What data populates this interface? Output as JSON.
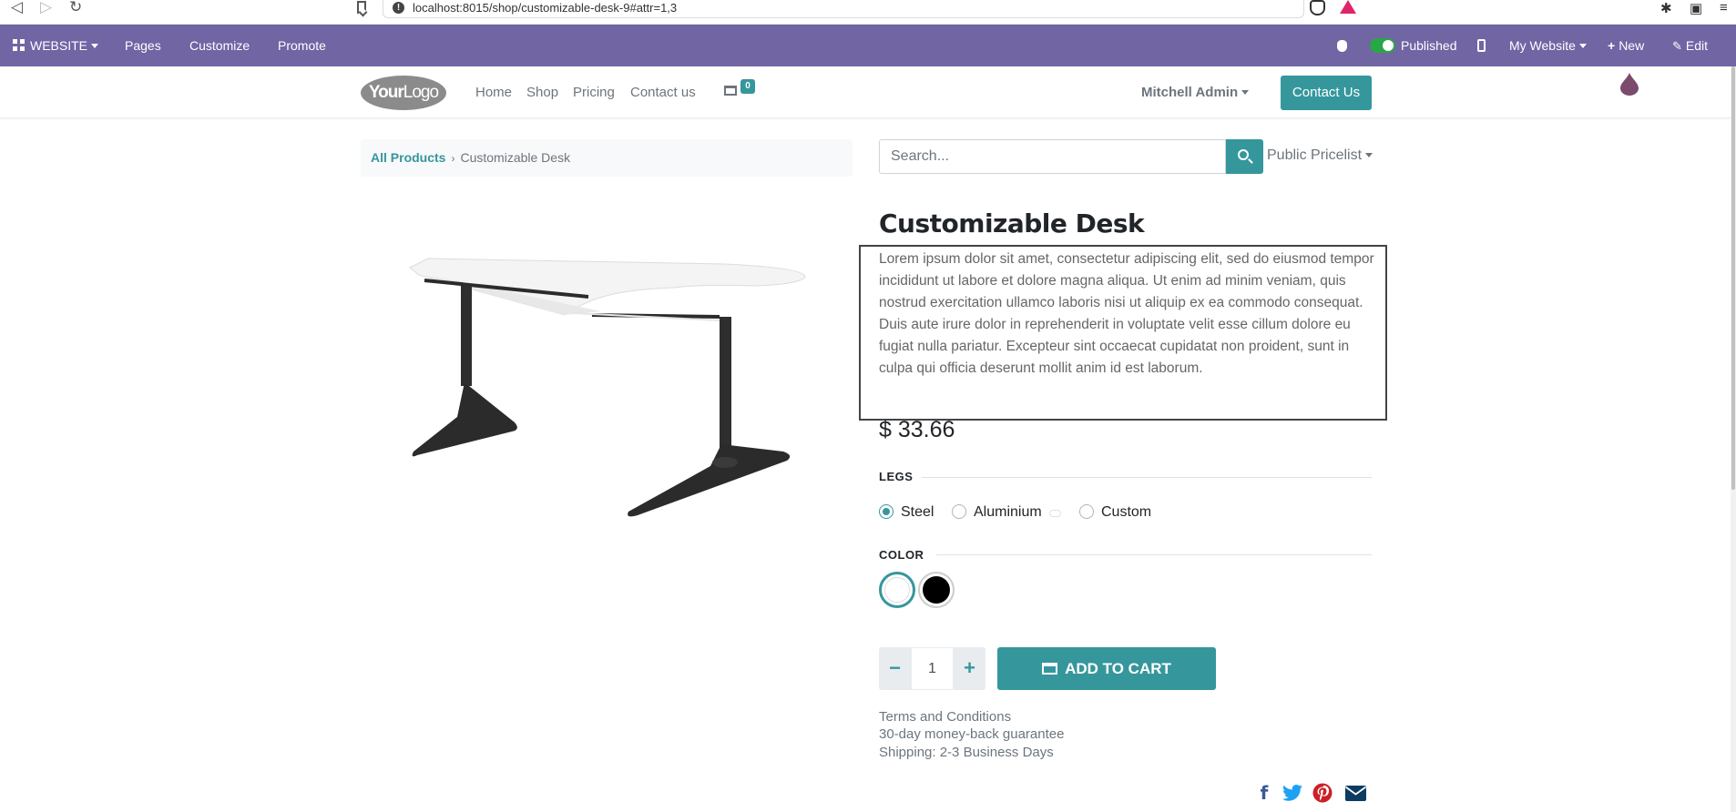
{
  "browser": {
    "url": "localhost:8015/shop/customizable-desk-9#attr=1,3",
    "nav_back": "◁",
    "nav_forward": "▷",
    "nav_reload": "↻"
  },
  "admin_bar": {
    "app_menu": "WEBSITE",
    "pages": "Pages",
    "customize": "Customize",
    "promote": "Promote",
    "published": "Published",
    "website": "My Website",
    "new": "New",
    "edit": "Edit",
    "color": "#7165a4"
  },
  "header": {
    "logo_bold": "Your",
    "logo_rest": "Logo",
    "nav": [
      "Home",
      "Shop",
      "Pricing",
      "Contact us"
    ],
    "cart_count": "0",
    "user": "Mitchell Admin",
    "contact_button": "Contact Us"
  },
  "breadcrumb": {
    "link": "All Products",
    "separator": "›",
    "current": "Customizable Desk"
  },
  "search": {
    "placeholder": "Search...",
    "pricelist": "Public Pricelist"
  },
  "product": {
    "title": "Customizable Desk",
    "description": "Lorem ipsum dolor sit amet, consectetur adipiscing elit, sed do eiusmod tempor incididunt ut labore et dolore magna aliqua. Ut enim ad minim veniam, quis nostrud exercitation ullamco laboris nisi ut aliquip ex ea commodo consequat. Duis aute irure dolor in reprehenderit in voluptate velit esse cillum dolore eu fugiat nulla pariatur. Excepteur sint occaecat cupidatat non proident, sunt in culpa qui officia deserunt mollit anim id est laborum.",
    "price": "$ 33.66",
    "legs_label": "LEGS",
    "legs_options": [
      "Steel",
      "Aluminium",
      "Custom"
    ],
    "legs_selected": "Steel",
    "color_label": "COLOR",
    "colors": [
      "#ffffff",
      "#000000"
    ],
    "color_selected": "#ffffff",
    "quantity": "1",
    "qty_minus": "−",
    "qty_plus": "+",
    "add_to_cart": "ADD TO CART"
  },
  "terms": {
    "line1": "Terms and Conditions",
    "line2": "30-day money-back guarantee",
    "line3": "Shipping: 2-3 Business Days"
  },
  "share": {
    "facebook": "f",
    "facebook_color": "#3b5998",
    "twitter_color": "#1da1f2",
    "pinterest_color": "#cb2027",
    "email_color": "#0d3b61"
  },
  "accent_color": "#35979c"
}
